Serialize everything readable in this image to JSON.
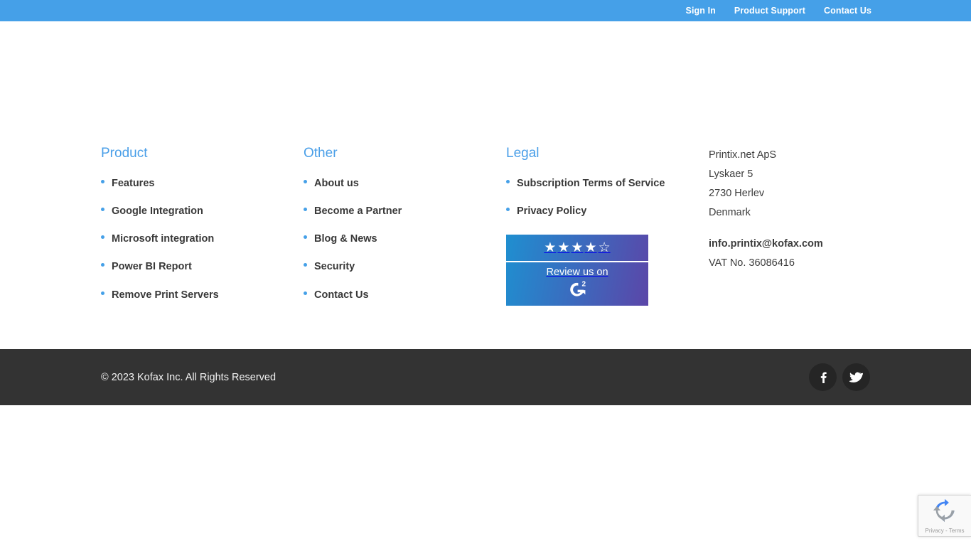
{
  "topbar": {
    "links": [
      {
        "label": "Sign In",
        "name": "sign-in-link"
      },
      {
        "label": "Product Support",
        "name": "product-support-link"
      },
      {
        "label": "Contact Us",
        "name": "contact-us-link"
      }
    ]
  },
  "columns": {
    "product": {
      "heading": "Product",
      "items": [
        "Features",
        "Google Integration",
        "Microsoft integration",
        "Power BI Report",
        "Remove Print Servers"
      ]
    },
    "other": {
      "heading": "Other",
      "items": [
        "About us",
        "Become a Partner",
        "Blog & News",
        "Security",
        "Contact Us"
      ]
    },
    "legal": {
      "heading": "Legal",
      "items": [
        "Subscription Terms of Service",
        "Privacy Policy"
      ]
    }
  },
  "g2_badge": {
    "stars_filled": 4,
    "stars_total": 5,
    "review_text": "Review us on",
    "logo_name": "g2-logo",
    "gradient_start": "#1f8fd0",
    "gradient_end": "#5b46a8"
  },
  "address": {
    "lines": [
      "Printix.net ApS",
      "Lyskaer 5",
      "2730 Herlev",
      "Denmark"
    ],
    "email": "info.printix@kofax.com",
    "vat": "VAT No. 36086416"
  },
  "copyright": {
    "text": "© 2023 Kofax Inc. All Rights Reserved",
    "socials": [
      {
        "name": "facebook-icon",
        "label": "Facebook"
      },
      {
        "name": "twitter-icon",
        "label": "Twitter"
      }
    ]
  },
  "recaptcha": {
    "text": "Privacy - Terms"
  },
  "colors": {
    "accent_blue": "#45a0e8",
    "heading_blue": "#4a9fe8",
    "dark_bar": "#333333",
    "link_text": "#393939"
  }
}
